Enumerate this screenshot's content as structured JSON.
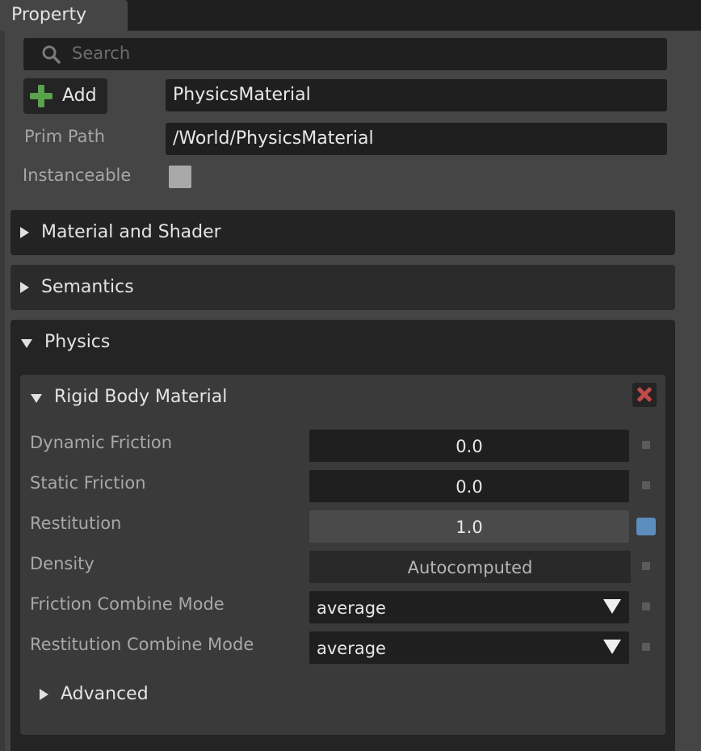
{
  "tab": {
    "title": "Property"
  },
  "search": {
    "placeholder": "Search"
  },
  "header": {
    "add_label": "Add",
    "prim_name": "PhysicsMaterial",
    "prim_path_label": "Prim Path",
    "prim_path": "/World/PhysicsMaterial",
    "instanceable_label": "Instanceable",
    "instanceable": false
  },
  "sections": {
    "material": "Material and Shader",
    "semantics": "Semantics",
    "physics": "Physics"
  },
  "rigid_body_material": {
    "title": "Rigid Body Material",
    "properties": [
      {
        "label": "Dynamic Friction",
        "value": "0.0"
      },
      {
        "label": "Static Friction",
        "value": "0.0"
      },
      {
        "label": "Restitution",
        "value": "1.0",
        "modified": true
      },
      {
        "label": "Density",
        "value": "Autocomputed"
      },
      {
        "label": "Friction Combine Mode",
        "value": "average"
      },
      {
        "label": "Restitution Combine Mode",
        "value": "average"
      }
    ],
    "advanced_label": "Advanced"
  },
  "colors": {
    "accent_blue": "#5b8dbd",
    "add_green": "#58a34c",
    "remove_red": "#c24a4a"
  },
  "icons": {
    "search": "search-icon",
    "add": "plus-icon",
    "remove": "close-icon",
    "expand": "triangle-icon",
    "dropdown": "dropdown-arrow-icon"
  }
}
